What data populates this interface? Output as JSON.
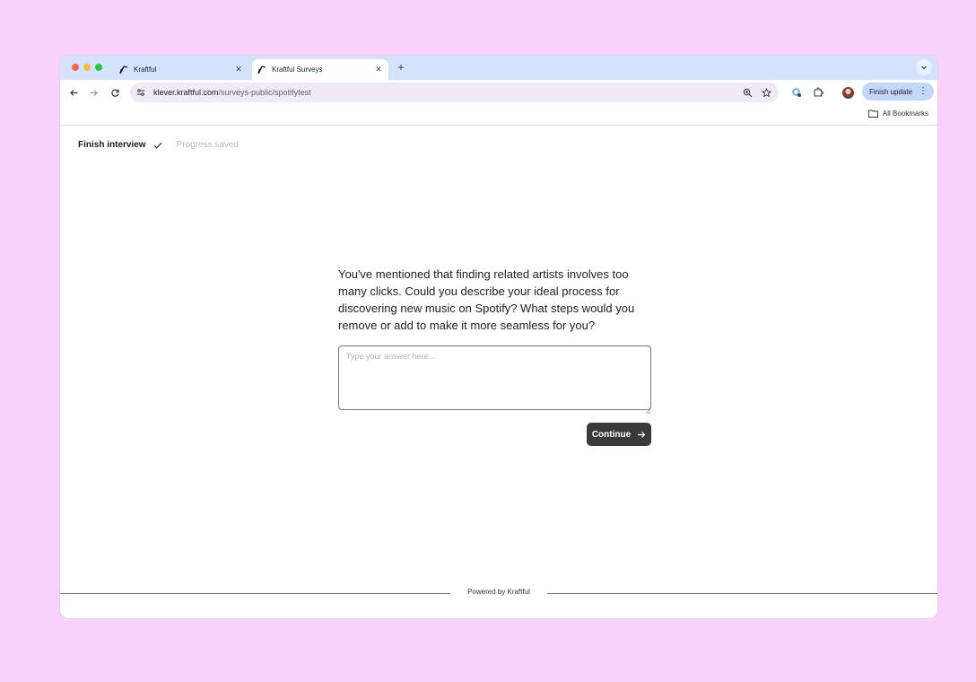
{
  "browser": {
    "tabs": [
      {
        "title": "Kraftful",
        "active": false
      },
      {
        "title": "Kraftful Surveys",
        "active": true
      }
    ],
    "new_tab": "+",
    "address": {
      "host": "klever.kraftful.com",
      "path": "/surveys-public/spotifytest"
    },
    "finish_update_label": "Finish update",
    "bookmarks_label": "All Bookmarks"
  },
  "survey": {
    "finish_label": "Finish interview",
    "progress_status": "Progress saved",
    "question": "You've mentioned that finding related artists involves too many clicks. Could you describe your ideal process for discovering new music on Spotify? What steps would you remove or add to make it more seamless for you?",
    "answer_placeholder": "Type your answer here...",
    "answer_value": "",
    "continue_label": "Continue"
  },
  "footer": {
    "powered_by": "Powered by Kraftful"
  },
  "colors": {
    "page_background": "#f9d2fb",
    "tabstrip": "#d3e3fd",
    "button": "#3a3a3a"
  }
}
